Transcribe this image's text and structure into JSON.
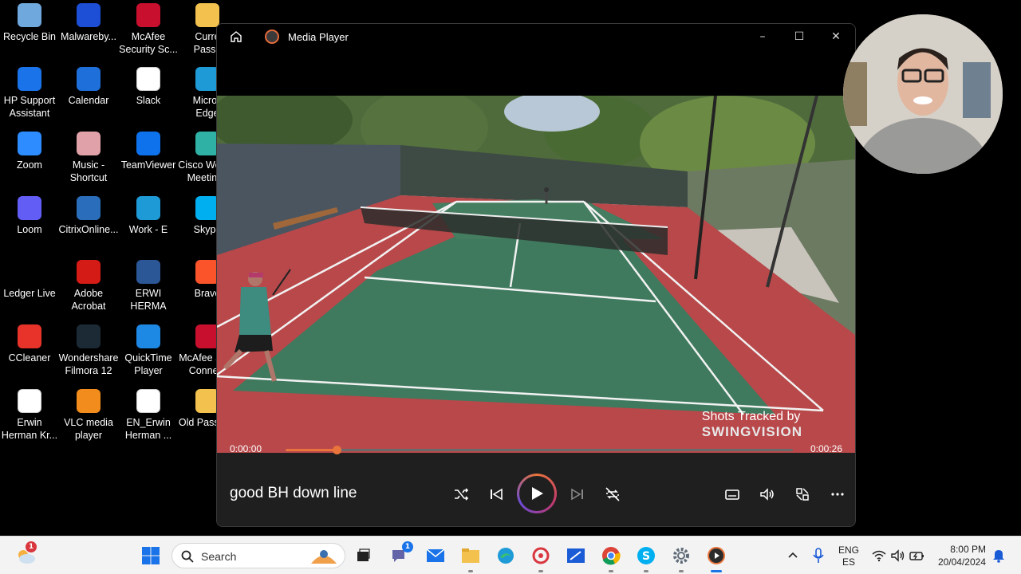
{
  "desktop": {
    "icons": [
      {
        "label": "Recycle Bin",
        "icon": "recycle-bin-icon",
        "color": "#6fa8dc"
      },
      {
        "label": "Malwareby...",
        "icon": "malwarebytes-icon",
        "color": "#1c4fd6"
      },
      {
        "label": "McAfee\nSecurity Sc...",
        "icon": "mcafee-icon",
        "color": "#c8102e"
      },
      {
        "label": "Curre\nPassp",
        "icon": "folder-icon",
        "color": "#f2c14e"
      },
      {
        "label": "HP Support\nAssistant",
        "icon": "hp-support-icon",
        "color": "#1a73e8"
      },
      {
        "label": "Calendar",
        "icon": "calendar-icon",
        "color": "#1e6fd9"
      },
      {
        "label": "Slack",
        "icon": "slack-icon",
        "color": "#ffffff"
      },
      {
        "label": "Micros\nEdge",
        "icon": "edge-icon",
        "color": "#1e9bd7"
      },
      {
        "label": "Zoom",
        "icon": "zoom-icon",
        "color": "#2d8cff"
      },
      {
        "label": "Music -\nShortcut",
        "icon": "music-folder-icon",
        "color": "#e0a2a8"
      },
      {
        "label": "TeamViewer",
        "icon": "teamviewer-icon",
        "color": "#0e72ed"
      },
      {
        "label": "Cisco Webex\nMeetings",
        "icon": "webex-icon",
        "color": "#2fb2a5"
      },
      {
        "label": "Loom",
        "icon": "loom-icon",
        "color": "#625df5"
      },
      {
        "label": "CitrixOnline...",
        "icon": "citrix-icon",
        "color": "#2a6ebb"
      },
      {
        "label": "Work - E",
        "icon": "edge-icon",
        "color": "#1e9bd7"
      },
      {
        "label": "Skype",
        "icon": "skype-icon",
        "color": "#00aff0"
      },
      {
        "label": "Ledger Live",
        "icon": "ledger-icon",
        "color": "#000000"
      },
      {
        "label": "Adobe\nAcrobat",
        "icon": "acrobat-icon",
        "color": "#d51b16"
      },
      {
        "label": "ERWI\nHERMA",
        "icon": "word-icon",
        "color": "#2b5797"
      },
      {
        "label": "Brave",
        "icon": "brave-icon",
        "color": "#fb542b"
      },
      {
        "label": "CCleaner",
        "icon": "ccleaner-icon",
        "color": "#e8332a"
      },
      {
        "label": "Wondershare\nFilmora 12",
        "icon": "filmora-icon",
        "color": "#1b2a34"
      },
      {
        "label": "QuickTime\nPlayer",
        "icon": "quicktime-icon",
        "color": "#1e88e5"
      },
      {
        "label": "McAfee Safe\nConnect",
        "icon": "mcafee-safe-connect-icon",
        "color": "#c8102e"
      },
      {
        "label": "Erwin\nHerman Kr...",
        "icon": "pdf-icon",
        "color": "#ffffff"
      },
      {
        "label": "VLC media\nplayer",
        "icon": "vlc-icon",
        "color": "#f28c1c"
      },
      {
        "label": "EN_Erwin\nHerman ...",
        "icon": "pdf-icon",
        "color": "#ffffff"
      },
      {
        "label": "Old Passport",
        "icon": "folder-icon",
        "color": "#f2c14e"
      }
    ]
  },
  "player": {
    "title": "Media Player",
    "media_title": "good BH down line",
    "time_current": "0:00:00",
    "time_duration": "0:00:26",
    "progress": 0.1,
    "watermark_line1": "Shots Tracked by",
    "watermark_brand": "SWINGVISION",
    "accent": "#e9743c"
  },
  "taskbar": {
    "search_label": "Search",
    "weather_badge": "1",
    "chat_badge": "1",
    "lang_top": "ENG",
    "lang_bottom": "ES",
    "time": "8:00 PM",
    "date": "20/04/2024"
  }
}
